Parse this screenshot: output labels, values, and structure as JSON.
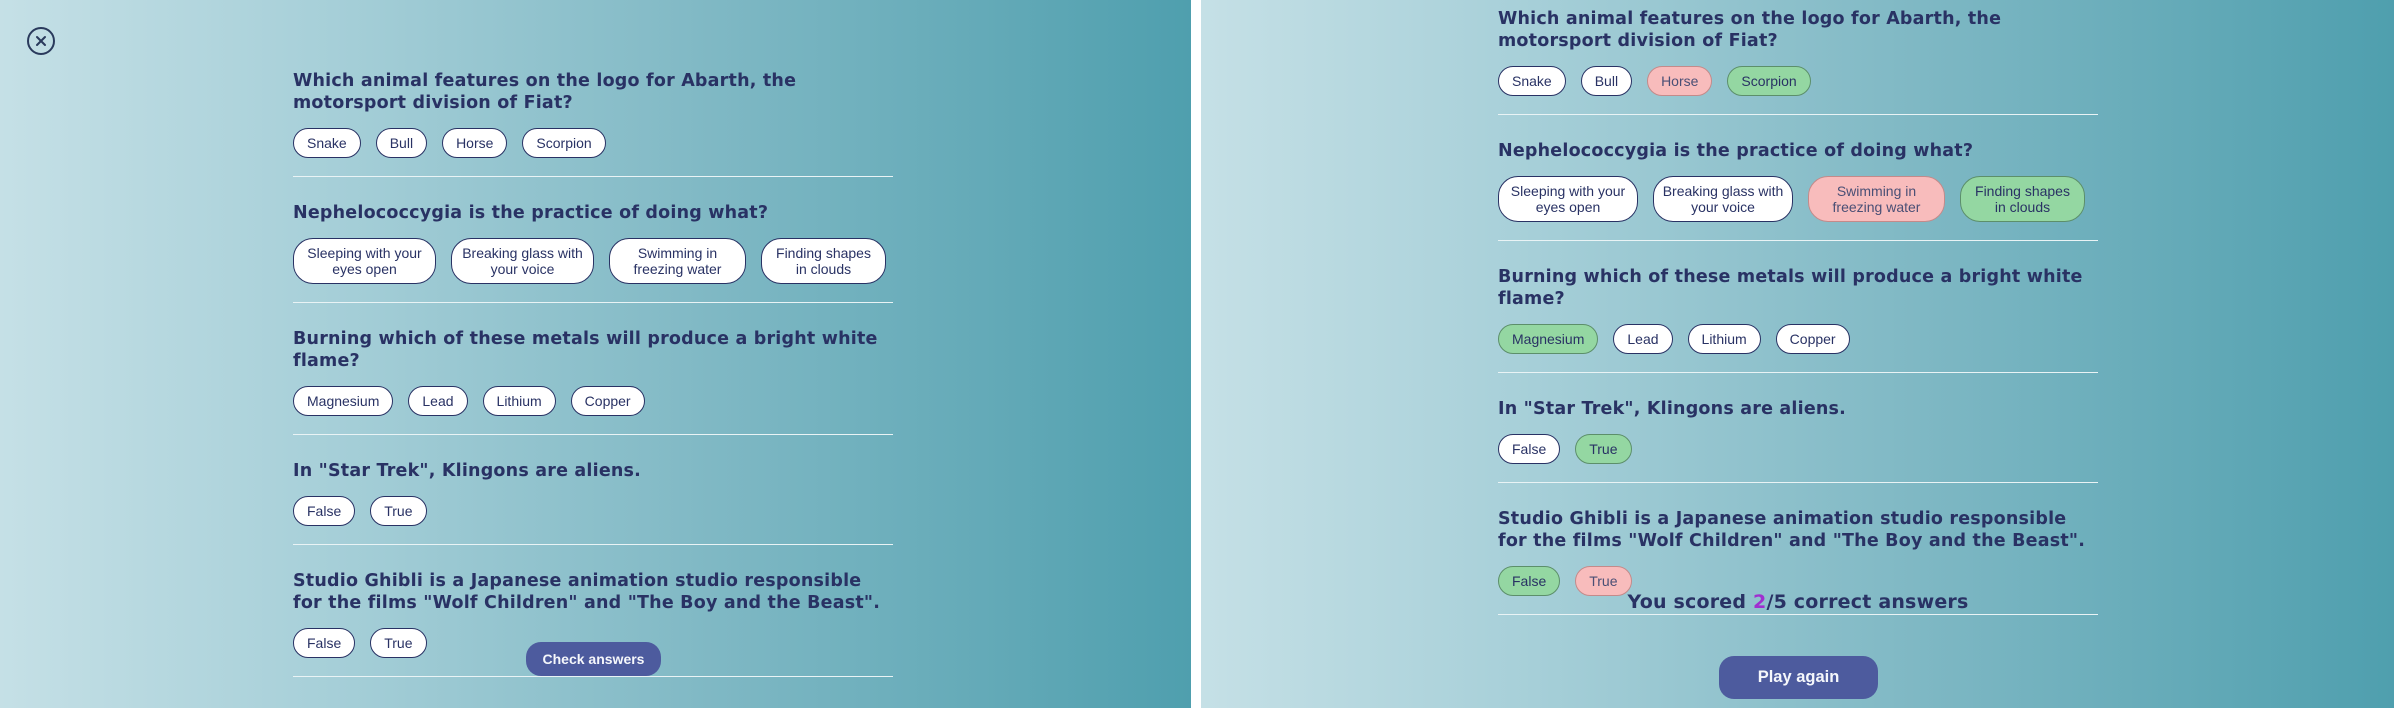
{
  "colors": {
    "text": "#293264",
    "button": "#4d5b9e",
    "correct": "#94d7a2",
    "incorrect": "#f8bcbc",
    "score_highlight": "#a02fd0"
  },
  "left": {
    "close_icon": "close-circle-icon",
    "questions": [
      {
        "text": "Which animal features on the logo for Abarth, the motorsport division of Fiat?",
        "answers": [
          "Snake",
          "Bull",
          "Horse",
          "Scorpion"
        ]
      },
      {
        "text": "Nephelococcygia is the practice of doing what?",
        "answers": [
          "Sleeping with your eyes open",
          "Breaking glass with your voice",
          "Swimming in freezing water",
          "Finding shapes in clouds"
        ]
      },
      {
        "text": "Burning which of these metals will produce a bright white flame?",
        "answers": [
          "Magnesium",
          "Lead",
          "Lithium",
          "Copper"
        ]
      },
      {
        "text": "In \"Star Trek\", Klingons are aliens.",
        "answers": [
          "False",
          "True"
        ]
      },
      {
        "text": "Studio Ghibli is a Japanese animation studio responsible for the films \"Wolf Children\" and \"The Boy and the Beast\".",
        "answers": [
          "False",
          "True"
        ]
      }
    ],
    "check_label": "Check answers"
  },
  "right": {
    "questions": [
      {
        "text": "Which animal features on the logo for Abarth, the motorsport division of Fiat?",
        "answers": [
          {
            "label": "Snake",
            "state": "neutral"
          },
          {
            "label": "Bull",
            "state": "neutral"
          },
          {
            "label": "Horse",
            "state": "incorrect"
          },
          {
            "label": "Scorpion",
            "state": "correct"
          }
        ]
      },
      {
        "text": "Nephelococcygia is the practice of doing what?",
        "answers": [
          {
            "label": "Sleeping with your eyes open",
            "state": "neutral"
          },
          {
            "label": "Breaking glass with your voice",
            "state": "neutral"
          },
          {
            "label": "Swimming in freezing water",
            "state": "incorrect"
          },
          {
            "label": "Finding shapes in clouds",
            "state": "correct"
          }
        ]
      },
      {
        "text": "Burning which of these metals will produce a bright white flame?",
        "answers": [
          {
            "label": "Magnesium",
            "state": "correct"
          },
          {
            "label": "Lead",
            "state": "neutral"
          },
          {
            "label": "Lithium",
            "state": "neutral"
          },
          {
            "label": "Copper",
            "state": "neutral"
          }
        ]
      },
      {
        "text": "In \"Star Trek\", Klingons are aliens.",
        "answers": [
          {
            "label": "False",
            "state": "neutral"
          },
          {
            "label": "True",
            "state": "correct"
          }
        ]
      },
      {
        "text": "Studio Ghibli is a Japanese animation studio responsible for the films \"Wolf Children\" and \"The Boy and the Beast\".",
        "answers": [
          {
            "label": "False",
            "state": "correct"
          },
          {
            "label": "True",
            "state": "incorrect"
          }
        ]
      }
    ],
    "score": {
      "prefix": "You scored ",
      "correct": "2",
      "total_suffix": "/5 correct answers"
    },
    "play_again_label": "Play again"
  }
}
